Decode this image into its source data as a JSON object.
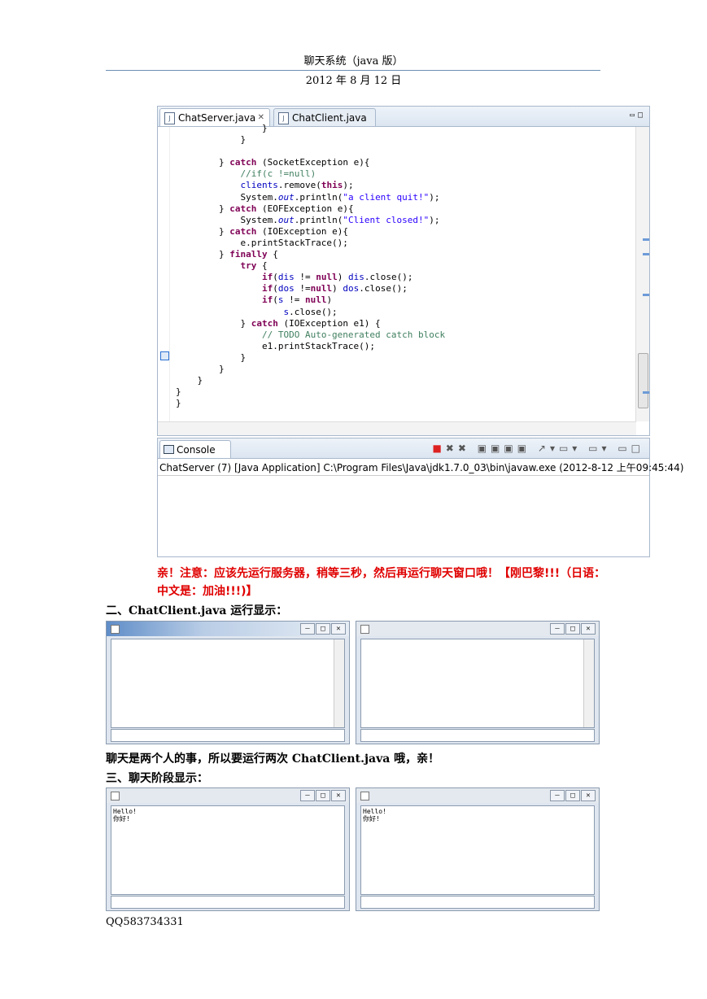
{
  "header": {
    "title": "聊天系统（java 版）",
    "date": "2012 年 8 月 12 日"
  },
  "editor": {
    "tabs": [
      {
        "label": "ChatServer.java"
      },
      {
        "label": "ChatClient.java"
      }
    ]
  },
  "console": {
    "tab_label": "Console",
    "launch_path": "ChatServer (7) [Java Application] C:\\Program Files\\Java\\jdk1.7.0_03\\bin\\javaw.exe (2012-8-12 上午09:45:44)"
  },
  "note_red": "亲！注意：应该先运行服务器，稍等三秒，然后再运行聊天窗口哦！【刚巴黎!!!（日语：中文是：加油!!!)】",
  "section2_title": "二、ChatClient.java 运行显示：",
  "between_text": "聊天是两个人的事，所以要运行两次 ChatClient.java 哦，亲！",
  "section3_title": "三、聊天阶段显示：",
  "chat_windows": [
    {
      "messages": "Hello!\n你好!"
    },
    {
      "messages": "Hello!\n你好!"
    }
  ],
  "footer": "QQ583734331"
}
